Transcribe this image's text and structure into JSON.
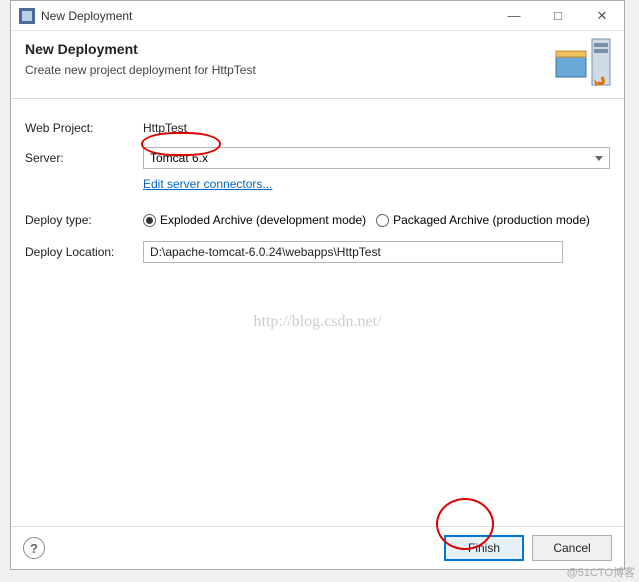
{
  "titlebar": {
    "title": "New Deployment"
  },
  "header": {
    "title": "New Deployment",
    "desc": "Create new project deployment for HttpTest"
  },
  "form": {
    "web_project_label": "Web Project:",
    "web_project_value": "HttpTest",
    "server_label": "Server:",
    "server_value": "Tomcat  6.x",
    "edit_connectors_link": "Edit server connectors...",
    "deploy_type_label": "Deploy type:",
    "radio_exploded": "Exploded Archive (development mode)",
    "radio_packaged": "Packaged Archive (production mode)",
    "deploy_location_label": "Deploy Location:",
    "deploy_location_value": "D:\\apache-tomcat-6.0.24\\webapps\\HttpTest"
  },
  "watermark": "http://blog.csdn.net/",
  "footer": {
    "finish": "Finish",
    "cancel": "Cancel"
  },
  "corner": "@51CTO博客"
}
